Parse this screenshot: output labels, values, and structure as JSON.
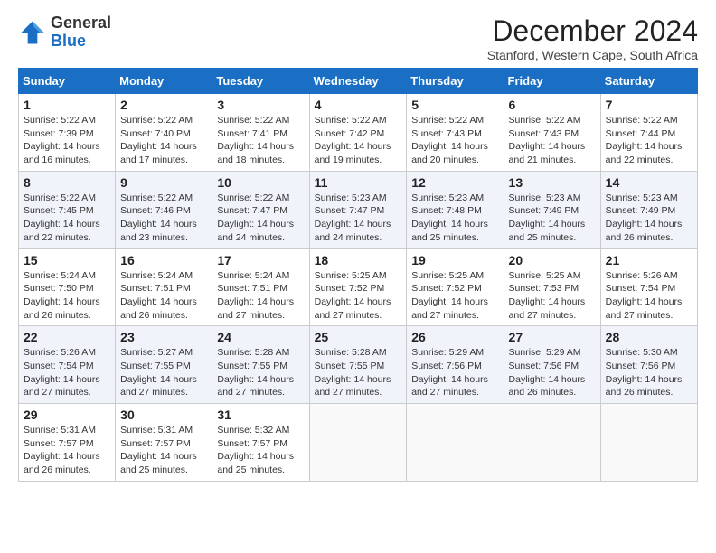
{
  "header": {
    "logo_line1": "General",
    "logo_line2": "Blue",
    "month_title": "December 2024",
    "subtitle": "Stanford, Western Cape, South Africa"
  },
  "columns": [
    "Sunday",
    "Monday",
    "Tuesday",
    "Wednesday",
    "Thursday",
    "Friday",
    "Saturday"
  ],
  "weeks": [
    [
      {
        "day": "1",
        "sunrise": "5:22 AM",
        "sunset": "7:39 PM",
        "daylight": "14 hours and 16 minutes."
      },
      {
        "day": "2",
        "sunrise": "5:22 AM",
        "sunset": "7:40 PM",
        "daylight": "14 hours and 17 minutes."
      },
      {
        "day": "3",
        "sunrise": "5:22 AM",
        "sunset": "7:41 PM",
        "daylight": "14 hours and 18 minutes."
      },
      {
        "day": "4",
        "sunrise": "5:22 AM",
        "sunset": "7:42 PM",
        "daylight": "14 hours and 19 minutes."
      },
      {
        "day": "5",
        "sunrise": "5:22 AM",
        "sunset": "7:43 PM",
        "daylight": "14 hours and 20 minutes."
      },
      {
        "day": "6",
        "sunrise": "5:22 AM",
        "sunset": "7:43 PM",
        "daylight": "14 hours and 21 minutes."
      },
      {
        "day": "7",
        "sunrise": "5:22 AM",
        "sunset": "7:44 PM",
        "daylight": "14 hours and 22 minutes."
      }
    ],
    [
      {
        "day": "8",
        "sunrise": "5:22 AM",
        "sunset": "7:45 PM",
        "daylight": "14 hours and 22 minutes."
      },
      {
        "day": "9",
        "sunrise": "5:22 AM",
        "sunset": "7:46 PM",
        "daylight": "14 hours and 23 minutes."
      },
      {
        "day": "10",
        "sunrise": "5:22 AM",
        "sunset": "7:47 PM",
        "daylight": "14 hours and 24 minutes."
      },
      {
        "day": "11",
        "sunrise": "5:23 AM",
        "sunset": "7:47 PM",
        "daylight": "14 hours and 24 minutes."
      },
      {
        "day": "12",
        "sunrise": "5:23 AM",
        "sunset": "7:48 PM",
        "daylight": "14 hours and 25 minutes."
      },
      {
        "day": "13",
        "sunrise": "5:23 AM",
        "sunset": "7:49 PM",
        "daylight": "14 hours and 25 minutes."
      },
      {
        "day": "14",
        "sunrise": "5:23 AM",
        "sunset": "7:49 PM",
        "daylight": "14 hours and 26 minutes."
      }
    ],
    [
      {
        "day": "15",
        "sunrise": "5:24 AM",
        "sunset": "7:50 PM",
        "daylight": "14 hours and 26 minutes."
      },
      {
        "day": "16",
        "sunrise": "5:24 AM",
        "sunset": "7:51 PM",
        "daylight": "14 hours and 26 minutes."
      },
      {
        "day": "17",
        "sunrise": "5:24 AM",
        "sunset": "7:51 PM",
        "daylight": "14 hours and 27 minutes."
      },
      {
        "day": "18",
        "sunrise": "5:25 AM",
        "sunset": "7:52 PM",
        "daylight": "14 hours and 27 minutes."
      },
      {
        "day": "19",
        "sunrise": "5:25 AM",
        "sunset": "7:52 PM",
        "daylight": "14 hours and 27 minutes."
      },
      {
        "day": "20",
        "sunrise": "5:25 AM",
        "sunset": "7:53 PM",
        "daylight": "14 hours and 27 minutes."
      },
      {
        "day": "21",
        "sunrise": "5:26 AM",
        "sunset": "7:54 PM",
        "daylight": "14 hours and 27 minutes."
      }
    ],
    [
      {
        "day": "22",
        "sunrise": "5:26 AM",
        "sunset": "7:54 PM",
        "daylight": "14 hours and 27 minutes."
      },
      {
        "day": "23",
        "sunrise": "5:27 AM",
        "sunset": "7:55 PM",
        "daylight": "14 hours and 27 minutes."
      },
      {
        "day": "24",
        "sunrise": "5:28 AM",
        "sunset": "7:55 PM",
        "daylight": "14 hours and 27 minutes."
      },
      {
        "day": "25",
        "sunrise": "5:28 AM",
        "sunset": "7:55 PM",
        "daylight": "14 hours and 27 minutes."
      },
      {
        "day": "26",
        "sunrise": "5:29 AM",
        "sunset": "7:56 PM",
        "daylight": "14 hours and 27 minutes."
      },
      {
        "day": "27",
        "sunrise": "5:29 AM",
        "sunset": "7:56 PM",
        "daylight": "14 hours and 26 minutes."
      },
      {
        "day": "28",
        "sunrise": "5:30 AM",
        "sunset": "7:56 PM",
        "daylight": "14 hours and 26 minutes."
      }
    ],
    [
      {
        "day": "29",
        "sunrise": "5:31 AM",
        "sunset": "7:57 PM",
        "daylight": "14 hours and 26 minutes."
      },
      {
        "day": "30",
        "sunrise": "5:31 AM",
        "sunset": "7:57 PM",
        "daylight": "14 hours and 25 minutes."
      },
      {
        "day": "31",
        "sunrise": "5:32 AM",
        "sunset": "7:57 PM",
        "daylight": "14 hours and 25 minutes."
      },
      null,
      null,
      null,
      null
    ]
  ],
  "labels": {
    "sunrise": "Sunrise:",
    "sunset": "Sunset:",
    "daylight": "Daylight: 14 hours"
  }
}
